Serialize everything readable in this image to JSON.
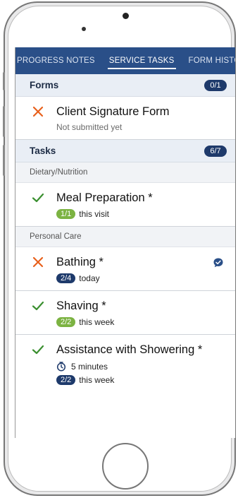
{
  "tabs": [
    {
      "label": "PROGRESS NOTES"
    },
    {
      "label": "SERVICE TASKS"
    },
    {
      "label": "FORM HISTORY"
    }
  ],
  "forms": {
    "title": "Forms",
    "count": "0/1",
    "items": [
      {
        "title": "Client Signature Form",
        "subtitle": "Not submitted yet",
        "status_icon": "x-icon"
      }
    ]
  },
  "tasks": {
    "title": "Tasks",
    "count": "6/7",
    "groups": [
      {
        "name": "Dietary/Nutrition",
        "items": [
          {
            "title": "Meal Preparation *",
            "badge": "1/1",
            "period": "this visit",
            "status_icon": "check-icon"
          }
        ]
      },
      {
        "name": "Personal Care",
        "items": [
          {
            "title": "Bathing *",
            "badge": "2/4",
            "period": "today",
            "status_icon": "x-icon"
          },
          {
            "title": "Shaving *",
            "badge": "2/2",
            "period": "this week",
            "status_icon": "check-icon"
          },
          {
            "title": "Assistance with Showering *",
            "duration": "5 minutes",
            "badge": "2/2",
            "period": "this week",
            "status_icon": "check-icon"
          }
        ]
      }
    ]
  },
  "colors": {
    "header": "#2a4f88",
    "check": "#3a8f2f",
    "cross": "#e8601c",
    "badge_green": "#7cb342",
    "badge_navy": "#1e3a6b"
  }
}
